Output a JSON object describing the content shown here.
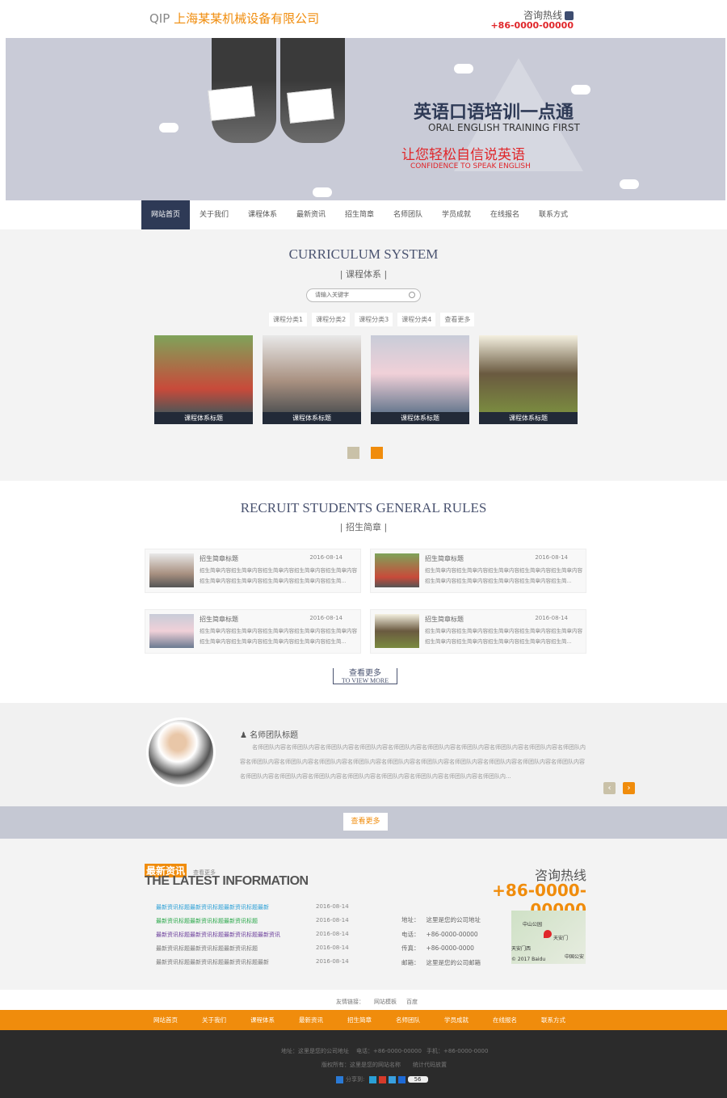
{
  "header": {
    "logo_prefix": "QIP",
    "company": "上海某某机械设备有限公司",
    "hotline_label": "咨询热线",
    "hotline": "+86-0000-00000"
  },
  "banner": {
    "title_cn": "英语口语培训一点通",
    "title_en": "ORAL ENGLISH TRAINING FIRST",
    "slogan_cn": "让您轻松自信说英语",
    "slogan_en": "CONFIDENCE TO SPEAK ENGLISH"
  },
  "nav": [
    "网站首页",
    "关于我们",
    "课程体系",
    "最新资讯",
    "招生简章",
    "名师团队",
    "学员成就",
    "在线报名",
    "联系方式"
  ],
  "curriculum": {
    "title_en": "CURRICULUM SYSTEM",
    "title_cn": "| 课程体系 |",
    "search_placeholder": "请输入关键字",
    "categories": [
      "课程分类1",
      "课程分类2",
      "课程分类3",
      "课程分类4",
      "查看更多"
    ],
    "cards": [
      "课程体系标题",
      "课程体系标题",
      "课程体系标题",
      "课程体系标题"
    ]
  },
  "recruit": {
    "title_en": "RECRUIT STUDENTS GENERAL RULES",
    "title_cn": "| 招生简章 |",
    "items": [
      {
        "title": "招生简章标题",
        "date": "2016-08-14",
        "text": "招生简章内容招生简章内容招生简章内容招生简章内容招生简章内容招生简章内容招生简章内容招生简章内容招生简章内容招生简..."
      },
      {
        "title": "招生简章标题",
        "date": "2016-08-14",
        "text": "招生简章内容招生简章内容招生简章内容招生简章内容招生简章内容招生简章内容招生简章内容招生简章内容招生简章内容招生简..."
      },
      {
        "title": "招生简章标题",
        "date": "2016-08-14",
        "text": "招生简章内容招生简章内容招生简章内容招生简章内容招生简章内容招生简章内容招生简章内容招生简章内容招生简章内容招生简..."
      },
      {
        "title": "招生简章标题",
        "date": "2016-08-14",
        "text": "招生简章内容招生简章内容招生简章内容招生简章内容招生简章内容招生简章内容招生简章内容招生简章内容招生简章内容招生简..."
      }
    ],
    "more_cn": "查看更多",
    "more_en": "TO VIEW MORE"
  },
  "team": {
    "title": "名师团队标题",
    "text": "名师团队内容名师团队内容名师团队内容名师团队内容名师团队内容名师团队内容名师团队内容名师团队内容名师团队内容名师团队内容名师团队内容名师团队内容名师团队内容名师团队内容名师团队内容名师团队内容名师团队内容名师团队内容名师团队内容名师团队内容名师团队内容名师团队内容名师团队内容名师团队内容名师团队内容名师团队内容名师团队内容名师团队内...",
    "more": "查看更多"
  },
  "news": {
    "tag": "最新资讯",
    "more": "查看更多",
    "title_en": "THE LATEST INFORMATION",
    "items": [
      {
        "title": "最新资讯标题最新资讯标题最新资讯标题最新",
        "date": "2016-08-14",
        "color": "#2a9fd6"
      },
      {
        "title": "最新资讯标题最新资讯标题最新资讯标题",
        "date": "2016-08-14",
        "color": "#2aa84a"
      },
      {
        "title": "最新资讯标题最新资讯标题最新资讯标题最新资讯",
        "date": "2016-08-14",
        "color": "#6a3d9a"
      },
      {
        "title": "最新资讯标题最新资讯标题最新资讯标题",
        "date": "2016-08-14",
        "color": "#777777"
      },
      {
        "title": "最新资讯标题最新资讯标题最新资讯标题最新",
        "date": "2016-08-14",
        "color": "#777777"
      }
    ]
  },
  "contact": {
    "hotline_label": "咨询热线",
    "hotline": "+86-0000-00000",
    "rows": [
      {
        "label": "地址：",
        "value": "这里是您的公司地址"
      },
      {
        "label": "电话：",
        "value": "+86-0000-00000"
      },
      {
        "label": "传真：",
        "value": "+86-0000-0000"
      },
      {
        "label": "邮箱：",
        "value": "这里是您的公司邮箱"
      }
    ],
    "map": {
      "label1": "中山公园",
      "label2": "天安门",
      "label3": "天安门西",
      "label4": "中国公安",
      "copyright": "© 2017 Baidu"
    }
  },
  "links": {
    "label": "友情链接：",
    "items": [
      "网站模板",
      "百度"
    ]
  },
  "footer": {
    "address": "地址：这里是您的公司地址",
    "phone": "电话：+86-0000-00000",
    "mobile": "手机：+86-0000-0000",
    "copyright": "版权所有：这里是您的网站名称",
    "stats": "统计代码放置",
    "share_label": "分享到:",
    "share_count": "56"
  }
}
